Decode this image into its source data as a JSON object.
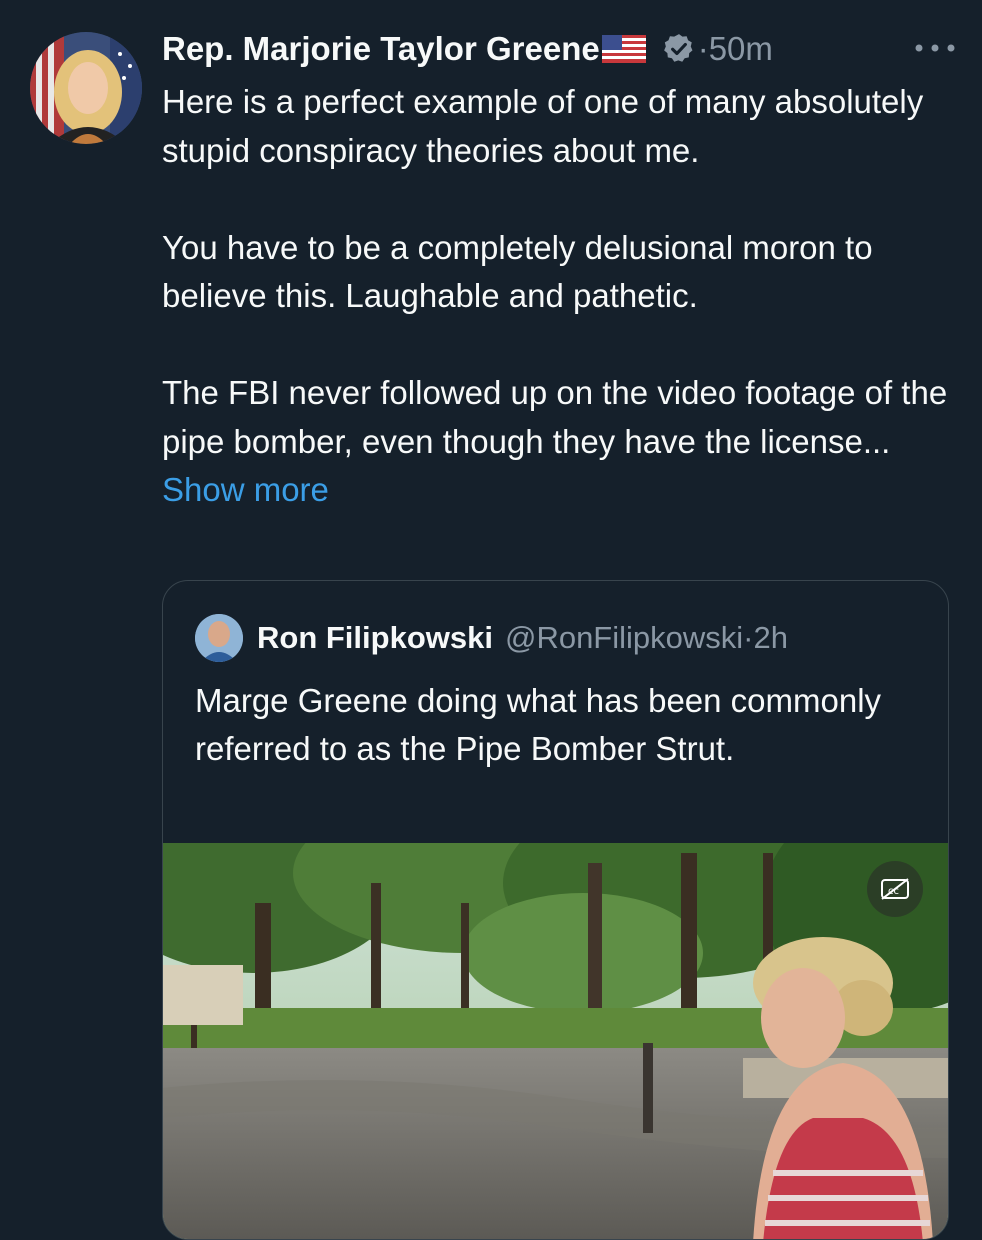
{
  "tweet": {
    "author_name": "Rep. Marjorie Taylor Greene",
    "separator": "·",
    "time": "50m",
    "paragraphs": [
      "Here is a perfect example of one of many absolutely stupid conspiracy theories about me.",
      "You have to be a completely delusional moron to believe this.  Laughable and pathetic.",
      "The FBI never followed up on the video footage of the pipe bomber, even though they have the license..."
    ],
    "show_more_label": "Show more",
    "more_icon": "more-dots-icon",
    "verified_icon": "verified-badge-icon",
    "flag_icon": "us-flag-icon"
  },
  "quote": {
    "author_name": "Ron Filipkowski",
    "handle": "@RonFilipkowski",
    "separator": "·",
    "time": "2h",
    "text": "Marge Greene doing what has been commonly referred to as the Pipe Bomber Strut.",
    "media": {
      "type": "video",
      "cc_icon": "captions-off-icon"
    }
  },
  "colors": {
    "background": "#15202b",
    "text": "#f7f9f9",
    "secondary": "#8b98a5",
    "link": "#3b9ee6",
    "border": "#38444d"
  }
}
